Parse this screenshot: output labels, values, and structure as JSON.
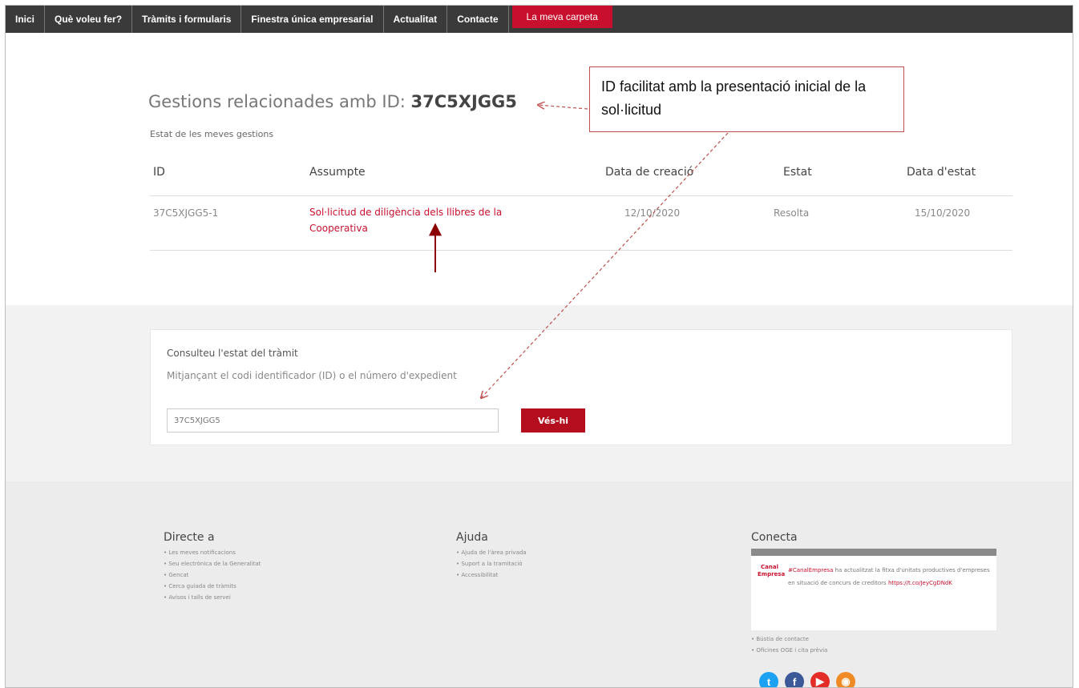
{
  "nav": {
    "items": [
      "Inici",
      "Què voleu fer?",
      "Tràmits i formularis",
      "Finestra única empresarial",
      "Actualitat",
      "Contacte"
    ],
    "active": "La meva carpeta"
  },
  "main": {
    "title_prefix": "Gestions relacionades amb ID: ",
    "title_id": "37C5XJGG5",
    "subtitle": "Estat de les meves gestions",
    "columns": {
      "id": "ID",
      "assumpte": "Assumpte",
      "data_creacio": "Data de creació",
      "estat": "Estat",
      "data_estat": "Data d'estat"
    },
    "rows": [
      {
        "id": "37C5XJGG5-1",
        "assumpte": "Sol·licitud de diligència dels llibres de la Cooperativa",
        "data_creacio": "12/10/2020",
        "estat": "Resolta",
        "data_estat": "15/10/2020"
      }
    ]
  },
  "query": {
    "title": "Consulteu l'estat del tràmit",
    "subtitle": "Mitjançant el codi identificador (ID) o el número d'expedient",
    "input_value": "37C5XJGG5",
    "button": "Vés-hi"
  },
  "footer": {
    "directe": {
      "title": "Directe a",
      "links": [
        "• Les meves notificacions",
        "• Seu electrònica de la Generalitat",
        "• Gencat",
        "• Cerca guiada de tràmits",
        "• Avisos i talls de servei"
      ]
    },
    "ajuda": {
      "title": "Ajuda",
      "links": [
        "• Ajuda de l'àrea privada",
        "• Suport a la tramitació",
        "• Accessibilitat"
      ]
    },
    "conecta": {
      "title": "Conecta",
      "tweet_logo": "Canal Empresa",
      "tweet_tag": "#CanalEmpresa",
      "tweet_text": " ha actualitzat la fitxa d'unitats productives d'empreses en situació de concurs de creditors ",
      "tweet_link": "https://t.co/JeyCgDNdK",
      "links": [
        "• Bústia de contacte",
        "• Oficines OGE i cita prèvia"
      ]
    }
  },
  "annotation": {
    "text": "ID facilitat amb la presentació inicial de la sol·licitud"
  },
  "colors": {
    "accent": "#c8102e",
    "nav_bg": "#3a3a3a",
    "annotation_arrow": "#c0504d"
  }
}
